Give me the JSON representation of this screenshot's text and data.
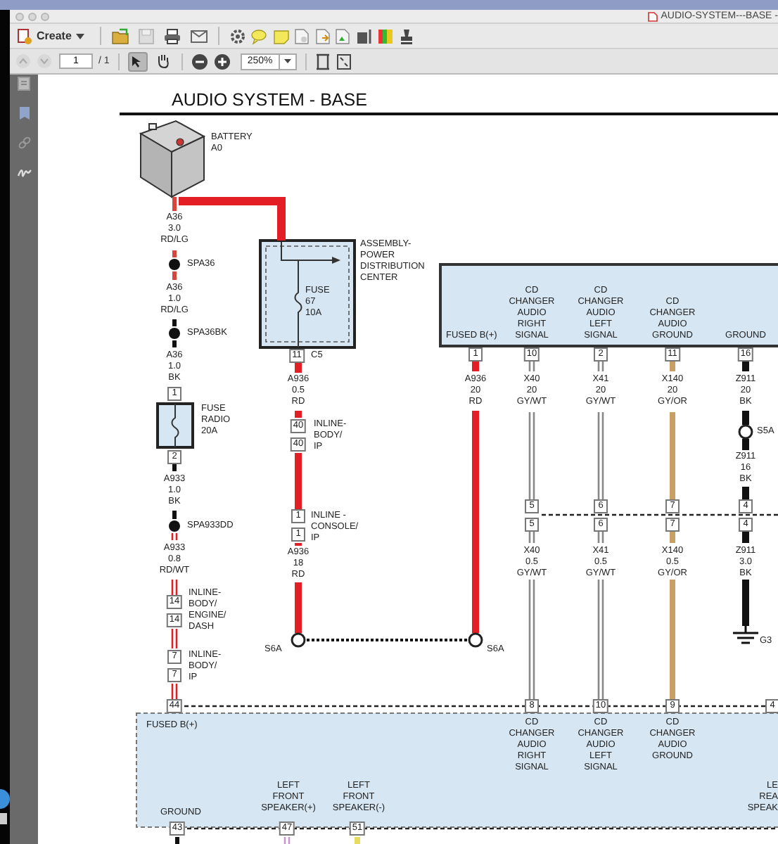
{
  "window": {
    "title": "AUDIO-SYSTEM---BASE -"
  },
  "toolbar": {
    "create_label": "Create",
    "page_value": "1",
    "page_total": "/ 1",
    "zoom_value": "250%",
    "tools": [
      {
        "selected": true
      },
      {
        "selected": false
      }
    ]
  },
  "diagram": {
    "title": "AUDIO SYSTEM - BASE",
    "labels": [
      "BATTERY\nA0",
      "A36\n3.0\nRD/LG",
      "SPA36",
      "A36\n1.0\nRD/LG",
      "SPA36BK",
      "A36\n1.0\nBK",
      "FUSE\nRADIO\n20A",
      "A933\n1.0\nBK",
      "SPA933DD",
      "A933\n0.8\nRD/WT",
      "INLINE-\nBODY/\nENGINE/\nDASH",
      "INLINE-\nBODY/\nIP",
      "ASSEMBLY-\nPOWER\nDISTRIBUTION\nCENTER",
      "FUSE\n67\n10A",
      "C5",
      "A936\n0.5\nRD",
      "INLINE-\nBODY/\nIP",
      "INLINE -\nCONSOLE/\nIP",
      "A936\n18\nRD",
      "FUSED B(+)",
      "CD\nCHANGER\nAUDIO\nRIGHT\nSIGNAL",
      "CD\nCHANGER\nAUDIO\nLEFT\nSIGNAL",
      "CD\nCHANGER\nAUDIO\nGROUND",
      "GROUND",
      "A936\n20\nRD",
      "X40\n20\nGY/WT",
      "X41\n20\nGY/WT",
      "X140\n20\nGY/OR",
      "Z911\n20\nBK",
      "S5A",
      "Z911\n16\nBK",
      "X40\n0.5\nGY/WT",
      "X41\n0.5\nGY/WT",
      "X140\n0.5\nGY/OR",
      "Z911\n3.0\nBK",
      "S6A",
      "S6A",
      "G3",
      "FUSED B(+)",
      "CD\nCHANGER\nAUDIO\nRIGHT\nSIGNAL",
      "CD\nCHANGER\nAUDIO\nLEFT\nSIGNAL",
      "CD\nCHANGER\nAUDIO\nGROUND",
      "GROUND",
      "LEFT\nFRONT\nSPEAKER(+)",
      "LEFT\nFRONT\nSPEAKER(-)",
      "LE\nREA\nSPEAK"
    ],
    "pins": [
      "11",
      "40",
      "40",
      "1",
      "1",
      "1",
      "2",
      "14",
      "14",
      "7",
      "7",
      "44",
      "1",
      "10",
      "2",
      "11",
      "16",
      "5",
      "6",
      "7",
      "4",
      "5",
      "6",
      "7",
      "4",
      "8",
      "10",
      "9",
      "4",
      "43",
      "47",
      "51"
    ],
    "wires": [
      {
        "color": "#e31e24",
        "kind": "single"
      },
      {
        "color": "#d8453a",
        "kind": "single"
      },
      {
        "color": "#111111",
        "kind": "single"
      },
      {
        "color": "#e31e24",
        "kind": "double"
      },
      {
        "color": "#e31e24",
        "kind": "single"
      },
      {
        "color": "#111111",
        "kind": "dotted"
      },
      {
        "color": "#e31e24",
        "kind": "single"
      },
      {
        "color": "#888888",
        "kind": "double"
      },
      {
        "color": "#888888",
        "kind": "double"
      },
      {
        "color": "#c9a063",
        "kind": "single"
      },
      {
        "color": "#111111",
        "kind": "single"
      },
      {
        "color": "#111111",
        "kind": "single"
      },
      {
        "color": "#c79bc9",
        "kind": "double"
      },
      {
        "color": "#e8dc60",
        "kind": "single"
      }
    ]
  }
}
